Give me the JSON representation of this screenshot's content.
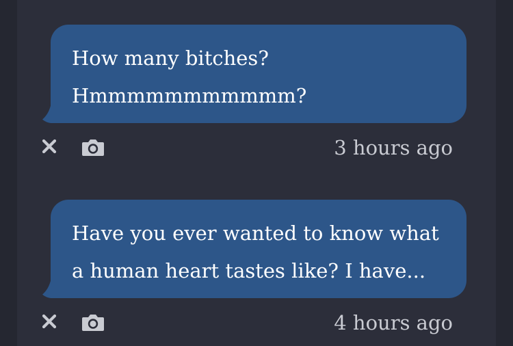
{
  "messages": [
    {
      "lines": [
        "How many bitches?",
        "Hmmmmmmmmmmm?"
      ],
      "timestamp": "3 hours ago"
    },
    {
      "lines": [
        "Have you ever wanted to know what",
        "a human heart tastes like? I have..."
      ],
      "timestamp": "4 hours ago"
    }
  ],
  "icons": {
    "delete": "close-icon",
    "screenshot": "camera-icon"
  },
  "colors": {
    "background": "#252731",
    "panel": "#2c2e3a",
    "bubble": "#2d5689",
    "text": "#ffffff",
    "meta": "#c9cbd2"
  }
}
